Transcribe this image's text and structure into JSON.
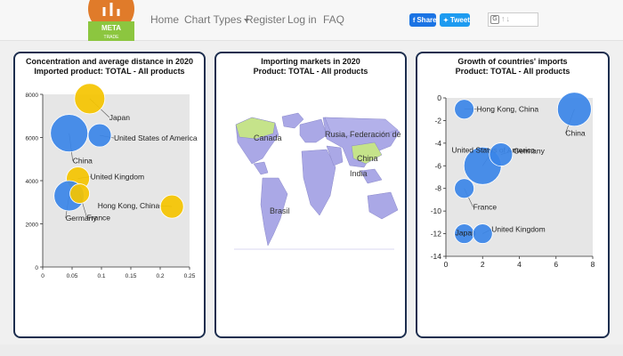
{
  "nav": {
    "logo_text": "META",
    "logo_sub": "TRADE",
    "items": [
      {
        "label": "Home"
      },
      {
        "label": "Chart Types"
      },
      {
        "label": "Register"
      },
      {
        "label": "Log in"
      },
      {
        "label": "FAQ"
      }
    ]
  },
  "share": {
    "facebook_label": "Share",
    "twitter_label": "Tweet"
  },
  "translate": {
    "icon": "google-translate-icon"
  },
  "colors": {
    "accent_navy": "#1d2e4e",
    "bubble_blue": "#3b86e8",
    "bubble_yellow": "#f5c400",
    "map_land": "#aaa8e6",
    "map_highlight": "#c5e38a"
  },
  "panels": [
    {
      "title_line1": "Concentration and average distance in 2020",
      "title_line2": "Imported product: TOTAL - All products"
    },
    {
      "title_line1": "Importing markets in 2020",
      "title_line2": "Product: TOTAL - All products",
      "map_labels": [
        "Canada",
        "Rusia, Federación de",
        "China",
        "India",
        "Brasil"
      ]
    },
    {
      "title_line1": "Growth of countries' imports",
      "title_line2": "Product: TOTAL - All products"
    }
  ],
  "chart_data": [
    {
      "type": "scatter",
      "title": "Concentration and average distance in 2020",
      "subtitle": "Imported product: TOTAL - All products",
      "xlim": [
        0,
        0.25
      ],
      "ylim": [
        0,
        8000
      ],
      "xticks": [
        "0",
        "0.05",
        "0.1",
        "0.15",
        "0.2",
        "0.25"
      ],
      "yticks": [
        "0",
        "2000",
        "4000",
        "6000",
        "8000"
      ],
      "grid": false,
      "points": [
        {
          "label": "Japan",
          "x": 0.08,
          "y": 7800,
          "size": 3,
          "color": "#f5c400"
        },
        {
          "label": "United States of America",
          "x": 0.097,
          "y": 6100,
          "size": 2,
          "color": "#3b86e8"
        },
        {
          "label": "China",
          "x": 0.045,
          "y": 6200,
          "size": 4,
          "color": "#3b86e8"
        },
        {
          "label": "United Kingdom",
          "x": 0.06,
          "y": 4100,
          "size": 2,
          "color": "#f5c400"
        },
        {
          "label": "Germany",
          "x": 0.045,
          "y": 3300,
          "size": 3,
          "color": "#3b86e8"
        },
        {
          "label": "France",
          "x": 0.063,
          "y": 3400,
          "size": 1.5,
          "color": "#f5c400"
        },
        {
          "label": "Hong Kong, China",
          "x": 0.22,
          "y": 2800,
          "size": 2,
          "color": "#f5c400"
        }
      ]
    },
    {
      "type": "scatter",
      "title": "Growth of countries' imports",
      "subtitle": "Product: TOTAL - All products",
      "xlim": [
        0,
        8
      ],
      "ylim": [
        -14,
        0
      ],
      "xticks": [
        "0",
        "2",
        "4",
        "6",
        "8"
      ],
      "yticks": [
        "0",
        "-2",
        "-4",
        "-6",
        "-8",
        "-10",
        "-12",
        "-14"
      ],
      "grid": false,
      "points": [
        {
          "label": "Hong Kong, China",
          "x": 1,
          "y": -1,
          "size": 1.5,
          "color": "#3b86e8"
        },
        {
          "label": "China",
          "x": 7,
          "y": -1,
          "size": 3.5,
          "color": "#3b86e8"
        },
        {
          "label": "United States of America",
          "x": 2,
          "y": -6,
          "size": 4,
          "color": "#3b86e8"
        },
        {
          "label": "Germany",
          "x": 3,
          "y": -5,
          "size": 2,
          "color": "#3b86e8"
        },
        {
          "label": "France",
          "x": 1,
          "y": -8,
          "size": 1.5,
          "color": "#3b86e8"
        },
        {
          "label": "Japan",
          "x": 1,
          "y": -12,
          "size": 1.5,
          "color": "#3b86e8"
        },
        {
          "label": "United Kingdom",
          "x": 2,
          "y": -12,
          "size": 1.5,
          "color": "#3b86e8"
        }
      ]
    }
  ]
}
